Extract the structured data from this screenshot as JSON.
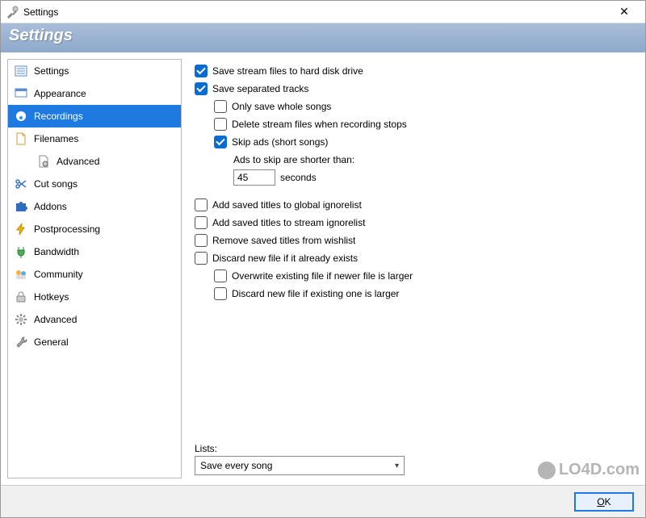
{
  "window": {
    "title": "Settings",
    "close_symbol": "✕"
  },
  "banner": {
    "title": "Settings"
  },
  "sidebar": {
    "items": [
      {
        "label": "Settings",
        "icon": "settings-list-icon",
        "selected": false,
        "child": false
      },
      {
        "label": "Appearance",
        "icon": "appearance-icon",
        "selected": false,
        "child": false
      },
      {
        "label": "Recordings",
        "icon": "recordings-icon",
        "selected": true,
        "child": false
      },
      {
        "label": "Filenames",
        "icon": "filenames-icon",
        "selected": false,
        "child": false
      },
      {
        "label": "Advanced",
        "icon": "advanced-file-icon",
        "selected": false,
        "child": true
      },
      {
        "label": "Cut songs",
        "icon": "scissors-icon",
        "selected": false,
        "child": false
      },
      {
        "label": "Addons",
        "icon": "puzzle-icon",
        "selected": false,
        "child": false
      },
      {
        "label": "Postprocessing",
        "icon": "lightning-icon",
        "selected": false,
        "child": false
      },
      {
        "label": "Bandwidth",
        "icon": "plug-icon",
        "selected": false,
        "child": false
      },
      {
        "label": "Community",
        "icon": "community-icon",
        "selected": false,
        "child": false
      },
      {
        "label": "Hotkeys",
        "icon": "lock-icon",
        "selected": false,
        "child": false
      },
      {
        "label": "Advanced",
        "icon": "gear-icon",
        "selected": false,
        "child": false
      },
      {
        "label": "General",
        "icon": "wrench-icon",
        "selected": false,
        "child": false
      }
    ]
  },
  "options": {
    "save_stream": {
      "label": "Save stream files to hard disk drive",
      "checked": true
    },
    "save_separated": {
      "label": "Save separated tracks",
      "checked": true
    },
    "only_whole": {
      "label": "Only save whole songs",
      "checked": false
    },
    "delete_on_stop": {
      "label": "Delete stream files when recording stops",
      "checked": false
    },
    "skip_ads": {
      "label": "Skip ads (short songs)",
      "checked": true
    },
    "ads_threshold_label": "Ads to skip are shorter than:",
    "ads_threshold_value": "45",
    "ads_threshold_unit": "seconds",
    "global_ignore": {
      "label": "Add saved titles to global ignorelist",
      "checked": false
    },
    "stream_ignore": {
      "label": "Add saved titles to stream ignorelist",
      "checked": false
    },
    "remove_wishlist": {
      "label": "Remove saved titles from wishlist",
      "checked": false
    },
    "discard_exists": {
      "label": "Discard new file if it already exists",
      "checked": false
    },
    "overwrite_larger": {
      "label": "Overwrite existing file if newer file is larger",
      "checked": false
    },
    "discard_larger": {
      "label": "Discard new file if existing one is larger",
      "checked": false
    }
  },
  "lists": {
    "label": "Lists:",
    "value": "Save every song"
  },
  "footer": {
    "ok_label": "OK"
  },
  "watermark": {
    "text": "LO4D.com"
  }
}
